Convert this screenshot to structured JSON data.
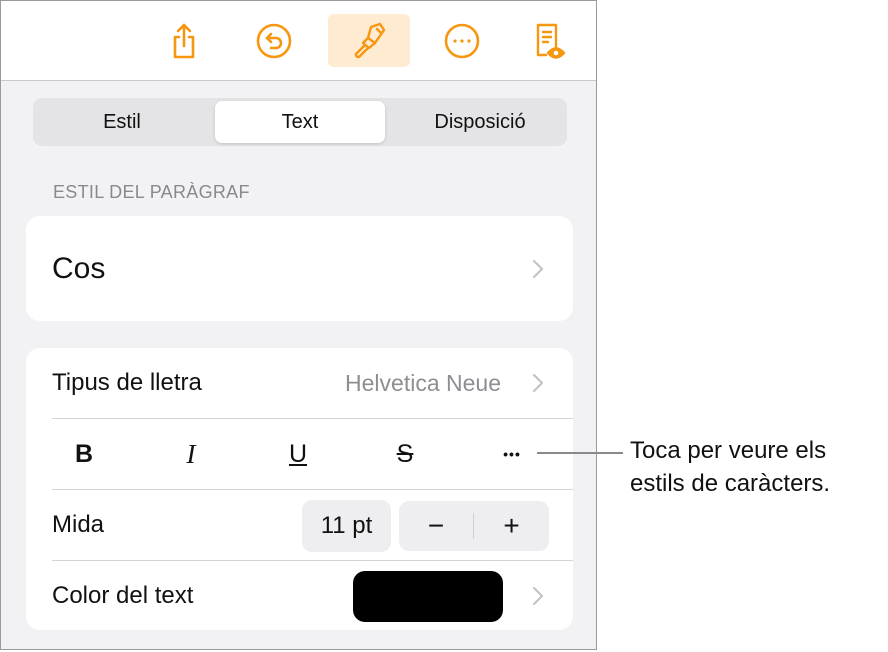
{
  "toolbar": {
    "buttons": [
      {
        "icon": "share-icon",
        "label": "Share"
      },
      {
        "icon": "undo-icon",
        "label": "Undo"
      },
      {
        "icon": "paintbrush-icon",
        "label": "Format",
        "active": true
      },
      {
        "icon": "more-icon",
        "label": "More"
      },
      {
        "icon": "document-preview-icon",
        "label": "Reading view"
      }
    ],
    "accent_color": "#f7960f"
  },
  "tabs": [
    {
      "label": "Estil",
      "active": false
    },
    {
      "label": "Text",
      "active": true
    },
    {
      "label": "Disposició",
      "active": false
    }
  ],
  "paragraph_style": {
    "section_label": "ESTIL DEL PARÀGRAF",
    "value": "Cos"
  },
  "font": {
    "label": "Tipus de lletra",
    "value": "Helvetica Neue"
  },
  "format_buttons": {
    "bold": "B",
    "italic": "I",
    "underline": "U",
    "strikethrough": "S",
    "more": "•••"
  },
  "size": {
    "label": "Mida",
    "value": "11 pt",
    "decrement": "−",
    "increment": "+"
  },
  "text_color": {
    "label": "Color del text",
    "swatch": "#000000"
  },
  "callout": {
    "line1": "Toca per veure els",
    "line2": "estils de caràcters."
  }
}
